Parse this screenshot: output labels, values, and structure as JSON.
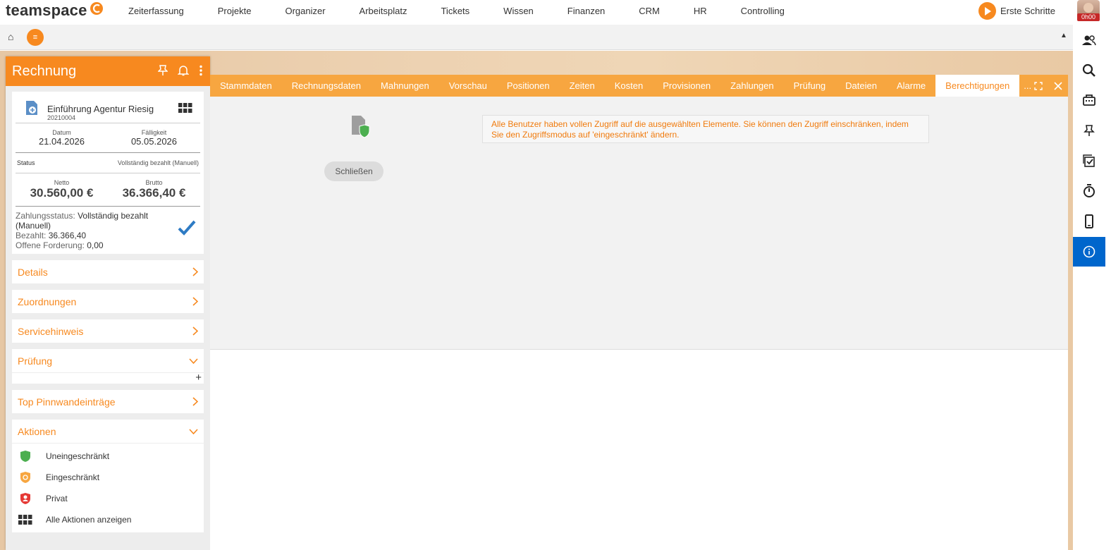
{
  "app": {
    "brand": "teamspace",
    "menu": [
      "Zeiterfassung",
      "Projekte",
      "Organizer",
      "Arbeitsplatz",
      "Tickets",
      "Wissen",
      "Finanzen",
      "CRM",
      "HR",
      "Controlling"
    ],
    "erste_schritte": "Erste Schritte",
    "timer": "0h00"
  },
  "subbar": {
    "home_icon": "⌂",
    "menu_icon": "≡",
    "collapse_icon": "▲"
  },
  "panel": {
    "title": "Rechnung",
    "doc_title": "Einführung Agentur Riesig",
    "doc_number": "20210004",
    "datum_label": "Datum",
    "datum": "21.04.2026",
    "faelligkeit_label": "Fälligkeit",
    "faelligkeit": "05.05.2026",
    "status_label": "Status",
    "status": "Vollständig bezahlt (Manuell)",
    "netto_label": "Netto",
    "netto": "30.560,00 €",
    "brutto_label": "Brutto",
    "brutto": "36.366,40 €",
    "zahlungsstatus_label": "Zahlungsstatus: ",
    "zahlungsstatus": "Vollständig bezahlt (Manuell)",
    "bezahlt_label": "Bezahlt: ",
    "bezahlt": "36.366,40",
    "offen_label": "Offene Forderung: ",
    "offen": "0,00",
    "sections": {
      "details": "Details",
      "zuordnungen": "Zuordnungen",
      "servicehinweis": "Servicehinweis",
      "pruefung": "Prüfung",
      "pinnwand": "Top Pinnwandeinträge",
      "aktionen": "Aktionen"
    },
    "actions": [
      "Uneingeschränkt",
      "Eingeschränkt",
      "Privat",
      "Alle Aktionen anzeigen"
    ]
  },
  "dialog": {
    "tabs": [
      "Stammdaten",
      "Rechnungsdaten",
      "Mahnungen",
      "Vorschau",
      "Positionen",
      "Zeiten",
      "Kosten",
      "Provisionen",
      "Zahlungen",
      "Prüfung",
      "Dateien",
      "Alarme",
      "Berechtigungen"
    ],
    "active_tab": "Berechtigungen",
    "more": "...",
    "info": "Alle Benutzer haben vollen Zugriff auf die ausgewählten Elemente. Sie können den Zugriff einschränken, indem Sie den Zugriffsmodus auf 'eingeschränkt' ändern.",
    "close_button": "Schließen"
  },
  "colors": {
    "accent": "#f7891f",
    "tabbar": "#f7a640",
    "rail_active": "#0066cc",
    "check": "#2e7bc4",
    "shield_green": "#4caf50",
    "shield_red": "#e53935"
  }
}
